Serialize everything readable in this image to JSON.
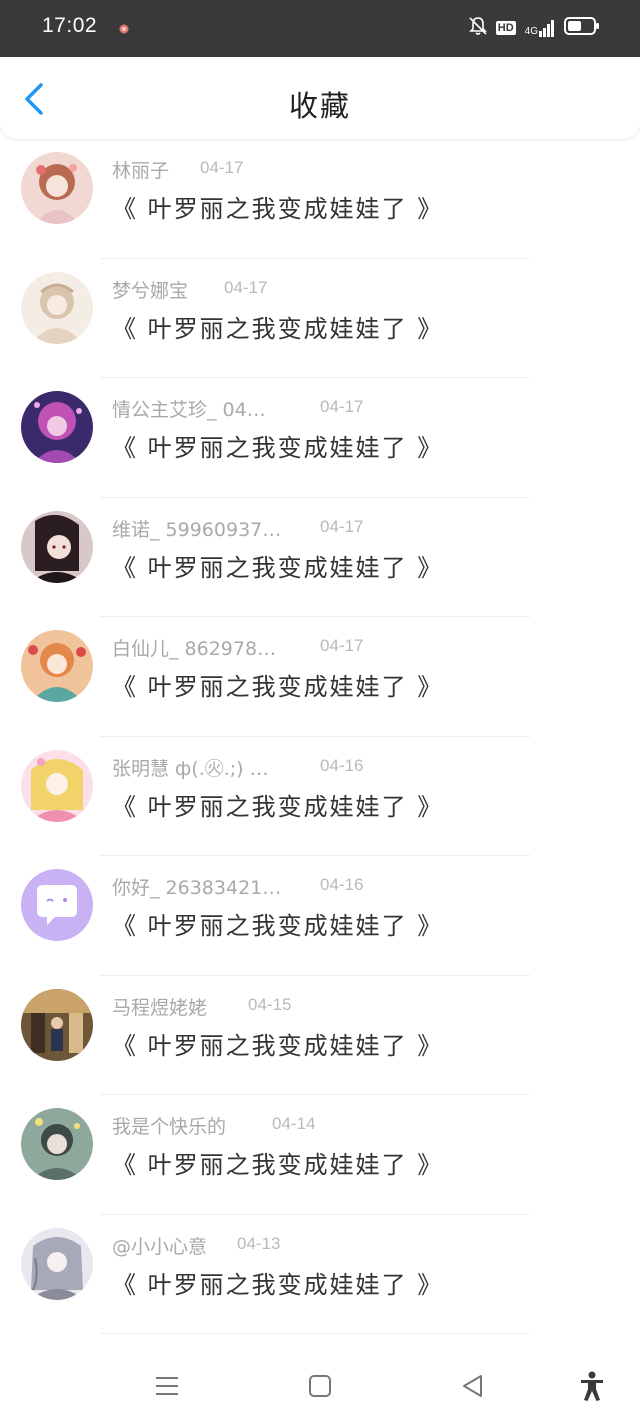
{
  "status_bar": {
    "time": "17:02",
    "hd": "HD",
    "network": "4G",
    "icons": [
      "notification-dot-icon",
      "bell-muted-icon",
      "hd-badge",
      "signal-icon",
      "battery-icon"
    ]
  },
  "header": {
    "title": "收藏",
    "back_icon": "chevron-left-icon",
    "accent_color": "#2196f3"
  },
  "list": {
    "items": [
      {
        "name": "林丽子",
        "date": "04-17",
        "text": "《 叶罗丽之我变成娃娃了 》",
        "avatar_color": "#d9a99a"
      },
      {
        "name": "梦兮娜宝",
        "date": "04-17",
        "text": "《 叶罗丽之我变成娃娃了 》",
        "avatar_color": "#e6d8cc"
      },
      {
        "name": "情公主艾珍_ 04…",
        "date": "04-17",
        "text": "《 叶罗丽之我变成娃娃了 》",
        "avatar_color": "#8a3f9e"
      },
      {
        "name": "维诺_ 59960937…",
        "date": "04-17",
        "text": "《 叶罗丽之我变成娃娃了 》",
        "avatar_color": "#3a2a2e"
      },
      {
        "name": "白仙儿_ 862978…",
        "date": "04-17",
        "text": "《 叶罗丽之我变成娃娃了 》",
        "avatar_color": "#e09a6a"
      },
      {
        "name": "张明慧 ф(.㊋.;) …",
        "date": "04-16",
        "text": "《 叶罗丽之我变成娃娃了 》",
        "avatar_color": "#f2b7c6"
      },
      {
        "name": "你好_ 26383421…",
        "date": "04-16",
        "text": "《 叶罗丽之我变成娃娃了 》",
        "avatar_color": "#c9b2f3"
      },
      {
        "name": "马程煜姥姥",
        "date": "04-15",
        "text": "《 叶罗丽之我变成娃娃了 》",
        "avatar_color": "#7a5a3a"
      },
      {
        "name": "我是个快乐的",
        "date": "04-14",
        "text": "《 叶罗丽之我变成娃娃了 》",
        "avatar_color": "#7f9a8f"
      },
      {
        "name": "@小小心意",
        "date": "04-13",
        "text": "《 叶罗丽之我变成娃娃了 》",
        "avatar_color": "#b8b8c4"
      }
    ]
  },
  "nav_bar": {
    "icons": [
      "menu-icon",
      "home-square-icon",
      "back-triangle-icon",
      "accessibility-icon"
    ]
  }
}
